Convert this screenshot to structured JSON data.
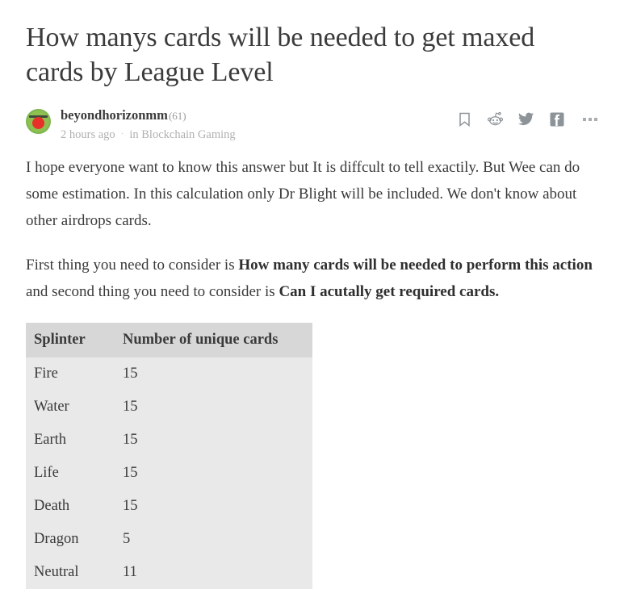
{
  "post": {
    "title": "How manys cards will be needed to get maxed cards by League Level",
    "author": {
      "name": "beyondhorizonmm",
      "reputation": "(61)"
    },
    "timestamp": "2 hours ago",
    "separator": "·",
    "community": "in Blockchain Gaming"
  },
  "actions": {
    "bookmark_label": "bookmark-icon",
    "reddit_label": "reddit-icon",
    "twitter_label": "twitter-icon",
    "facebook_label": "facebook-icon",
    "more_label": "more-options-icon"
  },
  "body": {
    "paragraph1": "I hope everyone want to know this answer but It is diffcult to tell exactily. But Wee can do some estimation. In this calculation only Dr Blight will be included. We don't know about other airdrops cards.",
    "paragraph2": {
      "part1": "First thing you need to consider is ",
      "bold1": "How many cards will be needed to perform this action",
      "part2": " and second thing you need to consider is ",
      "bold2": "Can I acutally get required cards."
    }
  },
  "table": {
    "headers": [
      "Splinter",
      "Number of unique cards"
    ],
    "rows": [
      {
        "splinter": "Fire",
        "count": "15"
      },
      {
        "splinter": "Water",
        "count": "15"
      },
      {
        "splinter": "Earth",
        "count": "15"
      },
      {
        "splinter": "Life",
        "count": "15"
      },
      {
        "splinter": "Death",
        "count": "15"
      },
      {
        "splinter": "Dragon",
        "count": "5"
      },
      {
        "splinter": "Neutral",
        "count": "11"
      }
    ]
  },
  "colors": {
    "text": "#3a3a3a",
    "muted": "#b0b0b0",
    "table_header_bg": "#d7d7d7",
    "table_body_bg": "#e9e9e9",
    "avatar_green": "#8ec04f",
    "avatar_red": "#e8302a",
    "icon_gray": "#8d9499"
  }
}
